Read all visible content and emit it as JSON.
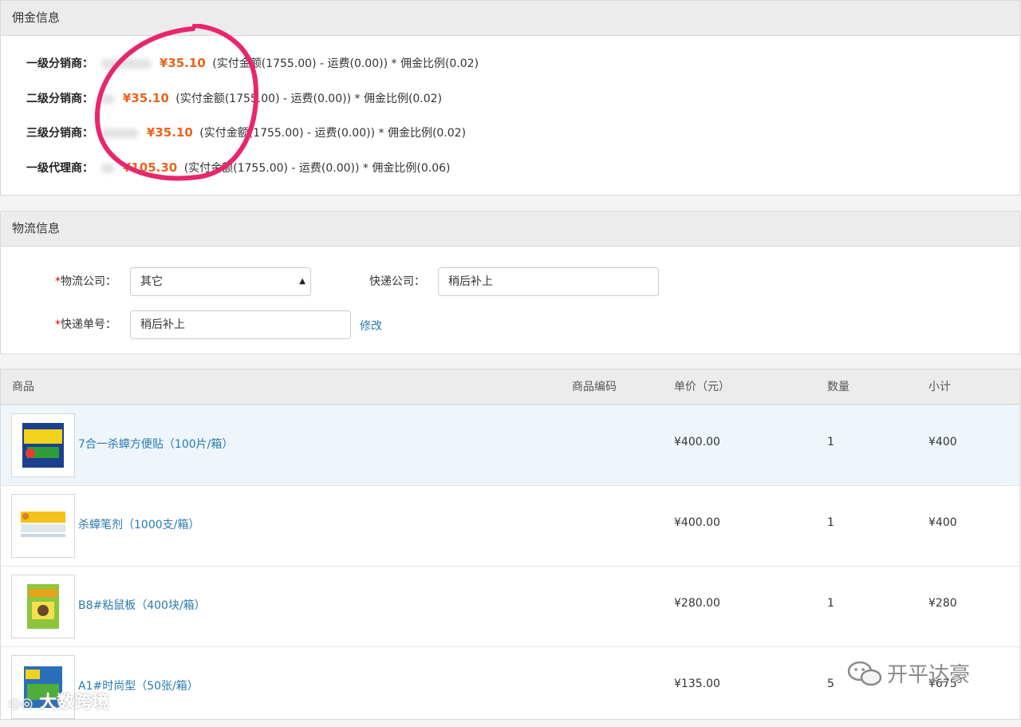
{
  "commission": {
    "title": "佣金信息",
    "rows": [
      {
        "label": "一级分销商：",
        "amount": "¥35.10",
        "formula": "(实付金额(1755.00) - 运费(0.00)) * 佣金比例(0.02)"
      },
      {
        "label": "二级分销商：",
        "amount": "¥35.10",
        "formula": "(实付金额(1755.00) - 运费(0.00)) * 佣金比例(0.02)"
      },
      {
        "label": "三级分销商：",
        "amount": "¥35.10",
        "formula": "(实付金额(1755.00) - 运费(0.00)) * 佣金比例(0.02)"
      },
      {
        "label": "一级代理商：",
        "amount": "¥105.30",
        "formula": "(实付金额(1755.00) - 运费(0.00)) * 佣金比例(0.06)"
      }
    ]
  },
  "logistics": {
    "title": "物流信息",
    "company_label": "物流公司：",
    "company_value": "其它",
    "express_label": "快递公司：",
    "express_value": "稍后补上",
    "tracking_label": "快递单号：",
    "tracking_value": "稍后补上",
    "edit_link": "修改",
    "required_mark": "*"
  },
  "products": {
    "headers": {
      "product": "商品",
      "code": "商品编码",
      "price": "单价（元）",
      "qty": "数量",
      "subtotal": "小计"
    },
    "rows": [
      {
        "name": "7合一杀蟑方便贴（100片/箱）",
        "code": "",
        "price": "¥400.00",
        "qty": "1",
        "subtotal": "¥400"
      },
      {
        "name": "杀蟑笔剂（1000支/箱）",
        "code": "",
        "price": "¥400.00",
        "qty": "1",
        "subtotal": "¥400"
      },
      {
        "name": "B8#粘鼠板（400块/箱）",
        "code": "",
        "price": "¥280.00",
        "qty": "1",
        "subtotal": "¥280"
      },
      {
        "name": "A1#时尚型（50张/箱）",
        "code": "",
        "price": "¥135.00",
        "qty": "5",
        "subtotal": "¥675"
      }
    ]
  },
  "watermarks": {
    "left": "大数跨境",
    "right": "开平达豪"
  },
  "colors": {
    "amount": "#e8641c",
    "link": "#2a7ab0",
    "circle": "#e8266e"
  }
}
